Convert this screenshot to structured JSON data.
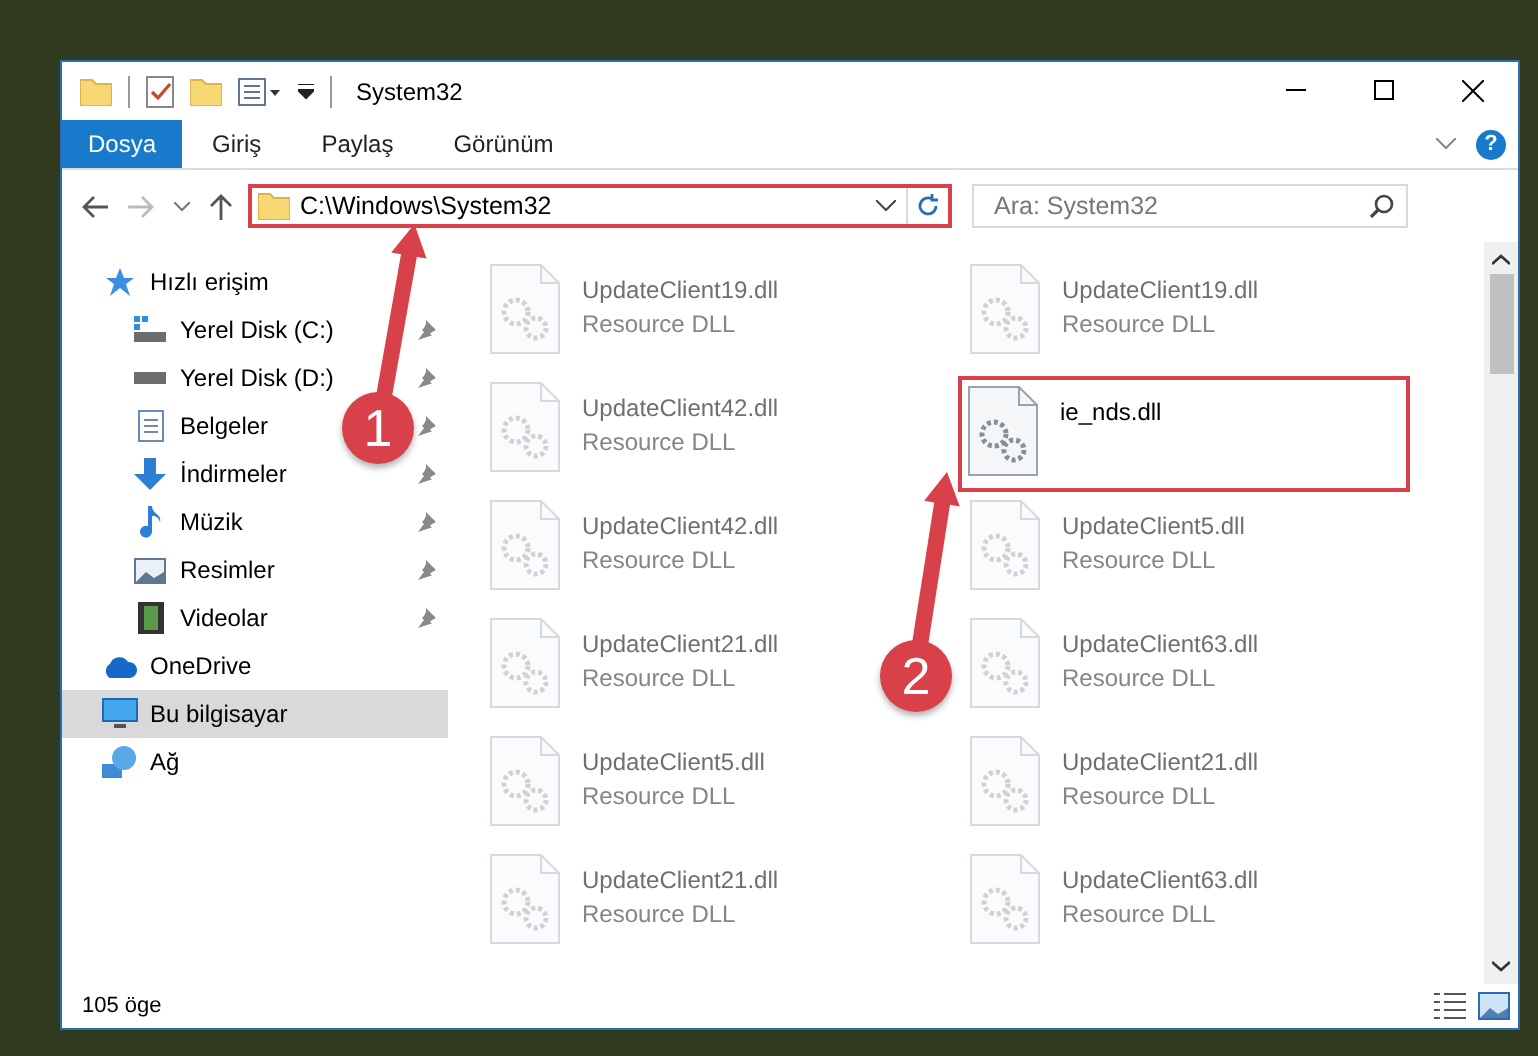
{
  "window": {
    "title": "System32"
  },
  "ribbon": {
    "tabs": [
      {
        "label": "Dosya",
        "selected": true
      },
      {
        "label": "Giriş",
        "selected": false
      },
      {
        "label": "Paylaş",
        "selected": false
      },
      {
        "label": "Görünüm",
        "selected": false
      }
    ],
    "help": "?"
  },
  "address_bar": {
    "path": "C:\\Windows\\System32",
    "highlighted": true
  },
  "search": {
    "placeholder": "Ara: System32"
  },
  "sidebar": {
    "items": [
      {
        "label": "Hızlı erişim",
        "kind": "star",
        "selected": false,
        "children": [
          {
            "label": "Yerel Disk (C:)",
            "kind": "drive-windows",
            "selected": false,
            "pinned": true
          },
          {
            "label": "Yerel Disk (D:)",
            "kind": "drive",
            "selected": false,
            "pinned": true
          },
          {
            "label": "Belgeler",
            "kind": "documents",
            "selected": false,
            "pinned": true
          },
          {
            "label": "İndirmeler",
            "kind": "download",
            "selected": false,
            "pinned": true
          },
          {
            "label": "Müzik",
            "kind": "music",
            "selected": false,
            "pinned": true
          },
          {
            "label": "Resimler",
            "kind": "pictures",
            "selected": false,
            "pinned": true
          },
          {
            "label": "Videolar",
            "kind": "videos",
            "selected": false,
            "pinned": true
          }
        ]
      },
      {
        "label": "OneDrive",
        "kind": "cloud",
        "selected": false
      },
      {
        "label": "Bu bilgisayar",
        "kind": "computer",
        "selected": true
      },
      {
        "label": "Ağ",
        "kind": "network",
        "selected": false
      }
    ]
  },
  "files": [
    {
      "name": "UpdateClient19.dll",
      "type": "Resource DLL",
      "highlighted": false
    },
    {
      "name": "UpdateClient19.dll",
      "type": "Resource DLL",
      "highlighted": false
    },
    {
      "name": "UpdateClient42.dll",
      "type": "Resource DLL",
      "highlighted": false
    },
    {
      "name": "ie_nds.dll",
      "highlighted": true
    },
    {
      "name": "UpdateClient42.dll",
      "type": "Resource DLL",
      "highlighted": false
    },
    {
      "name": "UpdateClient5.dll",
      "type": "Resource DLL",
      "highlighted": false
    },
    {
      "name": "UpdateClient21.dll",
      "type": "Resource DLL",
      "highlighted": false
    },
    {
      "name": "UpdateClient63.dll",
      "type": "Resource DLL",
      "highlighted": false
    },
    {
      "name": "UpdateClient5.dll",
      "type": "Resource DLL",
      "highlighted": false
    },
    {
      "name": "UpdateClient21.dll",
      "type": "Resource DLL",
      "highlighted": false
    },
    {
      "name": "UpdateClient21.dll",
      "type": "Resource DLL",
      "highlighted": false
    },
    {
      "name": "UpdateClient63.dll",
      "type": "Resource DLL",
      "highlighted": false
    }
  ],
  "status_bar": {
    "item_count": "105 öge"
  },
  "annotations": [
    {
      "number": "1"
    },
    {
      "number": "2"
    }
  ]
}
